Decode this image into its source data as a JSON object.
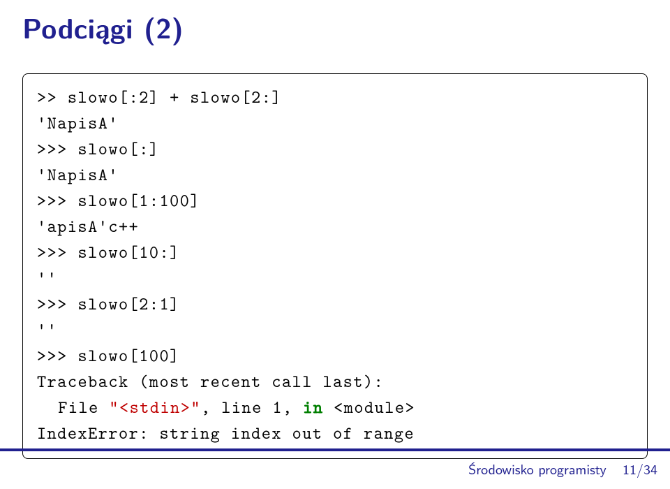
{
  "title": "Podciągi (2)",
  "code": {
    "l1_a": ">> slowo[:2] + slowo[2:]",
    "l2_a": "'NapisA'",
    "l3_a": ">>> slowo[:]",
    "l4_a": "'NapisA'",
    "l5_a": ">>> slowo[1:100]",
    "l6_a": "'apisA'c++",
    "l7_a": ">>> slowo[10:]",
    "l8_a": "''",
    "l9_a": ">>> slowo[2:1]",
    "l10_a": "''",
    "l11_a": ">>> slowo[100]",
    "l12_a": "Traceback (most recent call last):",
    "l13_a": "File ",
    "l13_b": "\"<stdin>\"",
    "l13_c": ", line 1, ",
    "l13_kw": "in",
    "l13_d": " <module>",
    "l14_a": "IndexError: string index out of range"
  },
  "footer": {
    "label": "Środowisko programisty",
    "page": "11/34"
  }
}
